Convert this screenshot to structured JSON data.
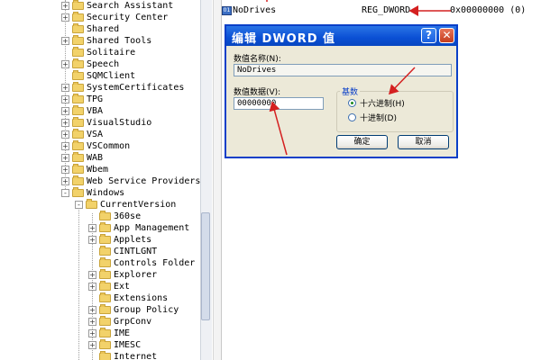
{
  "tree": {
    "items": [
      {
        "label": "Search Assistant",
        "expander": "+"
      },
      {
        "label": "Security Center",
        "expander": "+"
      },
      {
        "label": "Shared",
        "expander": ""
      },
      {
        "label": "Shared Tools",
        "expander": "+"
      },
      {
        "label": "Solitaire",
        "expander": ""
      },
      {
        "label": "Speech",
        "expander": "+"
      },
      {
        "label": "SQMClient",
        "expander": ""
      },
      {
        "label": "SystemCertificates",
        "expander": "+"
      },
      {
        "label": "TPG",
        "expander": "+"
      },
      {
        "label": "VBA",
        "expander": "+"
      },
      {
        "label": "VisualStudio",
        "expander": "+"
      },
      {
        "label": "VSA",
        "expander": "+"
      },
      {
        "label": "VSCommon",
        "expander": "+"
      },
      {
        "label": "WAB",
        "expander": "+"
      },
      {
        "label": "Wbem",
        "expander": "+"
      },
      {
        "label": "Web Service Providers",
        "expander": "+"
      },
      {
        "label": "Windows",
        "expander": "-"
      },
      {
        "label": "CurrentVersion",
        "expander": "-"
      },
      {
        "label": "360se",
        "expander": ""
      },
      {
        "label": "App Management",
        "expander": "+"
      },
      {
        "label": "Applets",
        "expander": "+"
      },
      {
        "label": "CINTLGNT",
        "expander": ""
      },
      {
        "label": "Controls Folder",
        "expander": ""
      },
      {
        "label": "Explorer",
        "expander": "+"
      },
      {
        "label": "Ext",
        "expander": "+"
      },
      {
        "label": "Extensions",
        "expander": ""
      },
      {
        "label": "Group Policy",
        "expander": "+"
      },
      {
        "label": "GrpConv",
        "expander": "+"
      },
      {
        "label": "IME",
        "expander": "+"
      },
      {
        "label": "IMESC",
        "expander": "+"
      },
      {
        "label": "Internet",
        "expander": ""
      }
    ]
  },
  "values": {
    "rows": [
      {
        "name": "NoDrives",
        "type": "REG_DWORD",
        "data": "0x00000000 (0)"
      }
    ]
  },
  "dialog": {
    "title": "编辑 DWORD 值",
    "help_label": "?",
    "close_label": "✕",
    "name_label": "数值名称(N):",
    "name_value": "NoDrives",
    "data_label": "数值数据(V):",
    "data_value": "00000000",
    "base_label": "基数",
    "hex_label": "十六进制(H)",
    "dec_label": "十进制(D)",
    "ok_label": "确定",
    "cancel_label": "取消"
  },
  "colors": {
    "titlebar": "#0a4fd4",
    "annotation": "#d42020"
  }
}
